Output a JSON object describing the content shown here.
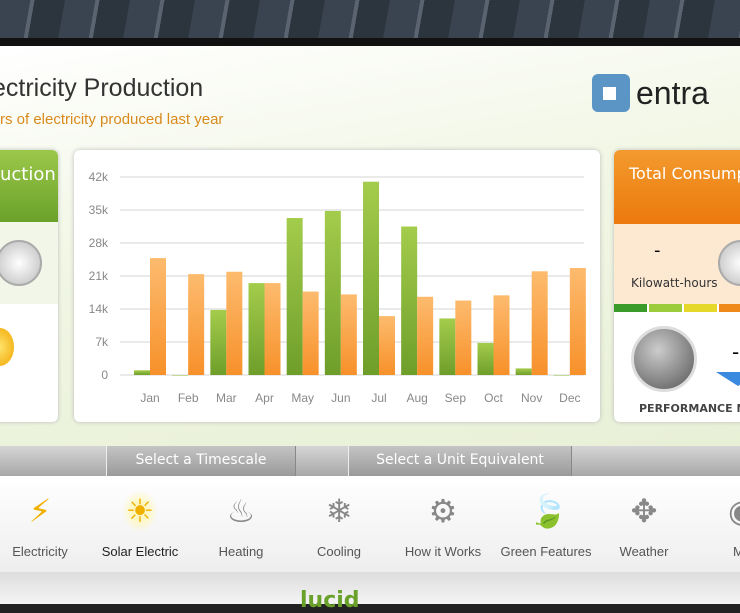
{
  "header": {
    "title": "ectricity Production",
    "subtitle": "rs of electricity produced last year",
    "logo_text": "entra"
  },
  "left_panel": {
    "title": "uction"
  },
  "right_panel": {
    "title": "Total Consump",
    "value": "-",
    "unit": "Kilowatt-hours",
    "performance_value": "-",
    "performance_label": "PERFORMANCE NC",
    "level_colors": [
      "#3a9a2a",
      "#9ccc3c",
      "#e6d82a",
      "#ef8a1a"
    ]
  },
  "selectors": {
    "timescale": "Select a Timescale",
    "unit": "Select a Unit Equivalent"
  },
  "nav": [
    {
      "label": "Electricity",
      "icon": "lightning-icon"
    },
    {
      "label": "Solar Electric",
      "icon": "sun-bulb-icon",
      "active": true
    },
    {
      "label": "Heating",
      "icon": "heating-radiator-icon"
    },
    {
      "label": "Cooling",
      "icon": "cooling-radiator-icon"
    },
    {
      "label": "How it Works",
      "icon": "gears-icon"
    },
    {
      "label": "Green Features",
      "icon": "leaf-icon"
    },
    {
      "label": "Weather",
      "icon": "weather-vane-icon"
    },
    {
      "label": "Mo",
      "icon": "film-reel-icon"
    }
  ],
  "footer": {
    "brand": "lucid"
  },
  "colors": {
    "green": "#7cb23a",
    "orange": "#f7952e"
  },
  "chart_data": {
    "type": "bar",
    "categories": [
      "Jan",
      "Feb",
      "Mar",
      "Apr",
      "May",
      "Jun",
      "Jul",
      "Aug",
      "Sep",
      "Oct",
      "Nov",
      "Dec"
    ],
    "series": [
      {
        "values": [
          1000,
          0,
          13800,
          19500,
          33300,
          34800,
          41000,
          31500,
          12000,
          6800,
          1400,
          0
        ],
        "color": "#7cb23a"
      },
      {
        "values": [
          24800,
          21400,
          21900,
          19500,
          17700,
          17100,
          12500,
          16600,
          15800,
          16900,
          22000,
          22700
        ],
        "color": "#f7952e"
      }
    ],
    "yticks": [
      "0",
      "7k",
      "14k",
      "21k",
      "28k",
      "35k",
      "42k"
    ],
    "ylim": [
      0,
      42000
    ],
    "grid": true
  }
}
